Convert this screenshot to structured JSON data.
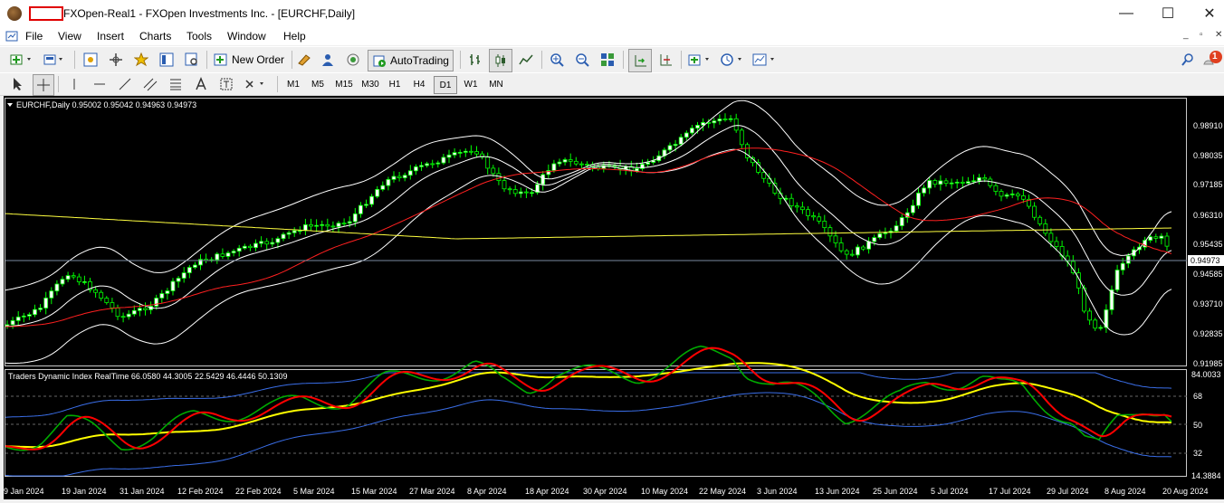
{
  "window": {
    "title": "FXOpen-Real1 - FXOpen Investments Inc. - [EURCHF,Daily]",
    "controls": {
      "minimize": "—",
      "maximize": "☐",
      "close": "✕"
    }
  },
  "menu": {
    "items": [
      "File",
      "View",
      "Insert",
      "Charts",
      "Tools",
      "Window",
      "Help"
    ],
    "mdi_controls": [
      "_",
      "▫",
      "✕"
    ]
  },
  "toolbar": {
    "new_order_label": "New Order",
    "autotrading_label": "AutoTrading",
    "notification_count": "1",
    "timeframes": [
      "M1",
      "M5",
      "M15",
      "M30",
      "H1",
      "H4",
      "D1",
      "W1",
      "MN"
    ],
    "active_timeframe": "D1"
  },
  "main_chart": {
    "header": "EURCHF,Daily  0.95002 0.95042 0.94963 0.94973",
    "current_price_label": "0.94973",
    "price_ticks": [
      "0.98910",
      "0.98035",
      "0.97185",
      "0.96310",
      "0.95435",
      "0.94585",
      "0.93710",
      "0.92835",
      "0.91985"
    ]
  },
  "indicator": {
    "header": "Traders Dynamic Index RealTime 66.0580 44.3005 22.5429 46.4446 50.1309",
    "ticks": [
      "84.0033",
      "68",
      "50",
      "32",
      "14.3884"
    ]
  },
  "time_axis": [
    "9 Jan 2024",
    "19 Jan 2024",
    "31 Jan 2024",
    "12 Feb 2024",
    "22 Feb 2024",
    "5 Mar 2024",
    "15 Mar 2024",
    "27 Mar 2024",
    "8 Apr 2024",
    "18 Apr 2024",
    "30 Apr 2024",
    "10 May 2024",
    "22 May 2024",
    "3 Jun 2024",
    "13 Jun 2024",
    "25 Jun 2024",
    "5 Jul 2024",
    "17 Jul 2024",
    "29 Jul 2024",
    "8 Aug 2024",
    "20 Aug 2024"
  ],
  "colors": {
    "chart_bg": "#000000",
    "candle_bull": "#ffffff",
    "candle_bear": "#000000",
    "wick": "#00ff00",
    "bollinger": "#ffffff",
    "ma_red": "#ff2020",
    "ma_yellow": "#ffff40",
    "tdi_green": "#00aa00",
    "tdi_red": "#ff0000",
    "tdi_yellow": "#ffff00",
    "tdi_band": "#3a6ee8"
  }
}
